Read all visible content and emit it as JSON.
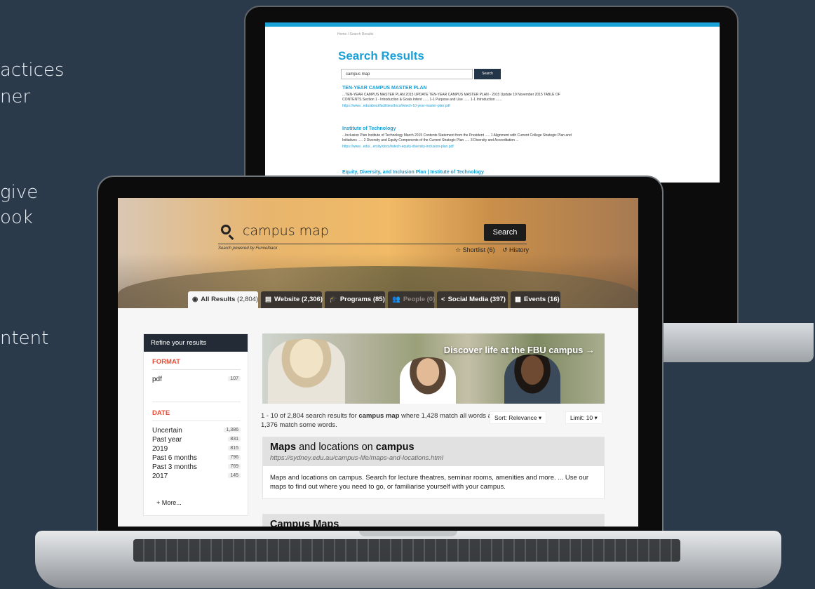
{
  "side_lines": [
    "actices",
    "ner",
    "give",
    "ook",
    "ntent"
  ],
  "back_screen": {
    "breadcrumb": "Home /    Search Results",
    "title": "Search Results",
    "query": "campus map",
    "search_label": "Search",
    "results": [
      {
        "title": "TEN-YEAR CAMPUS MASTER PLAN",
        "snippet": "...TEN-YEAR CAMPUS MASTER PLAN 2015 UPDATE TEN-YEAR CAMPUS MASTER PLAN - 2015 Update 19 November 2015 TABLE OF CONTENTS Section 1 - Introduction & Goals Intent ...... 1-1 Purpose and Use ...... 1-1 Introduction ......",
        "url": "https://www.          .edu/about/facilities/docs/lwtech-10-year-master-plan.pdf"
      },
      {
        "title": "Institute of Technology",
        "snippet": "...Inclusion Plan              Institute of Technology March 2015 Contents Statement from the President ..... 1 Alignment with Current College Strategic Plan and Initiatives ..... 2 Diversity and Equity Components of the Current Strategic Plan ..... 3 Diversity and Accreditation ...",
        "url": "https://www.          .edu/...ersity/docs/lwtech-equity-diversity-inclusion-plan.pdf"
      },
      {
        "title": "Equity, Diversity, and Inclusion Plan |                   Institute of Technology",
        "snippet": "",
        "url": ""
      }
    ]
  },
  "front_screen": {
    "query": "campus map",
    "search_label": "Search",
    "powered": "Search powered by Funnelback",
    "shortlist": "☆ Shortlist (6)",
    "history": "↺ History",
    "tabs": [
      {
        "icon": "◉",
        "label": "All Results",
        "count": "(2,804)"
      },
      {
        "icon": "▤",
        "label": "Website",
        "count": "(2,306)"
      },
      {
        "icon": "🎓",
        "label": "Programs",
        "count": "(85)"
      },
      {
        "icon": "👥",
        "label": "People",
        "count": "(0)"
      },
      {
        "icon": "<",
        "label": "Social Media",
        "count": "(397)"
      },
      {
        "icon": "▦",
        "label": "Events",
        "count": "(16)"
      }
    ],
    "refine_title": "Refine your results",
    "format_title": "FORMAT",
    "format_items": [
      {
        "label": "pdf",
        "count": "107"
      }
    ],
    "date_title": "DATE",
    "date_items": [
      {
        "label": "Uncertain",
        "count": "1,386"
      },
      {
        "label": "Past year",
        "count": "831"
      },
      {
        "label": "2019",
        "count": "815"
      },
      {
        "label": "Past 6 months",
        "count": "796"
      },
      {
        "label": "Past 3 months",
        "count": "769"
      },
      {
        "label": "2017",
        "count": "145"
      }
    ],
    "more_label": "+ More...",
    "banner_text": "Discover life at the FBU campus →",
    "summary_pre": "1 - 10 of 2,804 search results for ",
    "summary_query": "campus map",
    "summary_post": " where 1,428 match all words and 1,376 match some words.",
    "sort_label": "Sort: Relevance ▾",
    "limit_label": "Limit: 10 ▾",
    "results": [
      {
        "title_a": "Maps",
        "title_b": " and locations on ",
        "title_c": "campus",
        "url": "https://sydney.edu.au/campus-life/maps-and-locations.html",
        "snippet": "Maps and locations on campus. Search for lecture theatres, seminar rooms, amenities and more. ... Use our maps to find out where you need to go, or familiarise yourself with your campus."
      },
      {
        "title_a": "Campus Maps",
        "title_b": "",
        "title_c": "",
        "url": "",
        "snippet": ""
      }
    ]
  }
}
